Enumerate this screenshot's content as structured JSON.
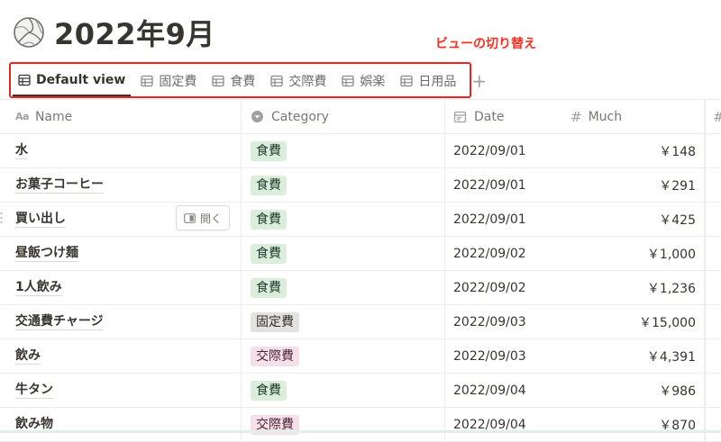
{
  "page": {
    "title": "2022年9月",
    "icon": "volleyball-icon"
  },
  "annotation": {
    "text": "ビューの切り替え",
    "color": "#ff2d1f",
    "box_color": "#e8261f"
  },
  "tabs": [
    {
      "label": "Default view",
      "icon": "table-icon",
      "active": true
    },
    {
      "label": "固定費",
      "icon": "table-icon",
      "active": false
    },
    {
      "label": "食費",
      "icon": "table-icon",
      "active": false
    },
    {
      "label": "交際費",
      "icon": "table-icon",
      "active": false
    },
    {
      "label": "娯楽",
      "icon": "table-icon",
      "active": false
    },
    {
      "label": "日用品",
      "icon": "table-icon",
      "active": false
    }
  ],
  "add_view_label": "+",
  "table": {
    "columns": [
      {
        "label": "Name",
        "icon": "text-property-icon",
        "icon_text": "Aa"
      },
      {
        "label": "Category",
        "icon": "select-property-icon"
      },
      {
        "label": "Date",
        "icon": "calendar-icon"
      },
      {
        "label": "Much",
        "icon": "number-property-icon",
        "icon_text": "#"
      },
      {
        "label": "",
        "icon": "number-property-icon",
        "icon_text": "#"
      }
    ],
    "rows": [
      {
        "name": "水",
        "category": "食費",
        "category_color": "#dbeddb",
        "date": "2022/09/01",
        "much": "￥148"
      },
      {
        "name": "お菓子コーヒー",
        "category": "食費",
        "category_color": "#dbeddb",
        "date": "2022/09/01",
        "much": "￥291"
      },
      {
        "name": "買い出し",
        "category": "食費",
        "category_color": "#dbeddb",
        "date": "2022/09/01",
        "much": "￥425"
      },
      {
        "name": "昼飯つけ麺",
        "category": "食費",
        "category_color": "#dbeddb",
        "date": "2022/09/02",
        "much": "￥1,000"
      },
      {
        "name": "1人飲み",
        "category": "食費",
        "category_color": "#dbeddb",
        "date": "2022/09/02",
        "much": "￥1,236"
      },
      {
        "name": "交通費チャージ",
        "category": "固定費",
        "category_color": "#e3e2e0",
        "date": "2022/09/03",
        "much": "￥15,000"
      },
      {
        "name": "飲み",
        "category": "交際費",
        "category_color": "#f5e0e9",
        "date": "2022/09/03",
        "much": "￥4,391"
      },
      {
        "name": "牛タン",
        "category": "食費",
        "category_color": "#dbeddb",
        "date": "2022/09/04",
        "much": "￥986"
      },
      {
        "name": "飲み物",
        "category": "交際費",
        "category_color": "#f5e0e9",
        "date": "2022/09/04",
        "much": "￥870"
      }
    ]
  },
  "open_button": {
    "label": "開く",
    "icon": "side-peek-icon"
  }
}
